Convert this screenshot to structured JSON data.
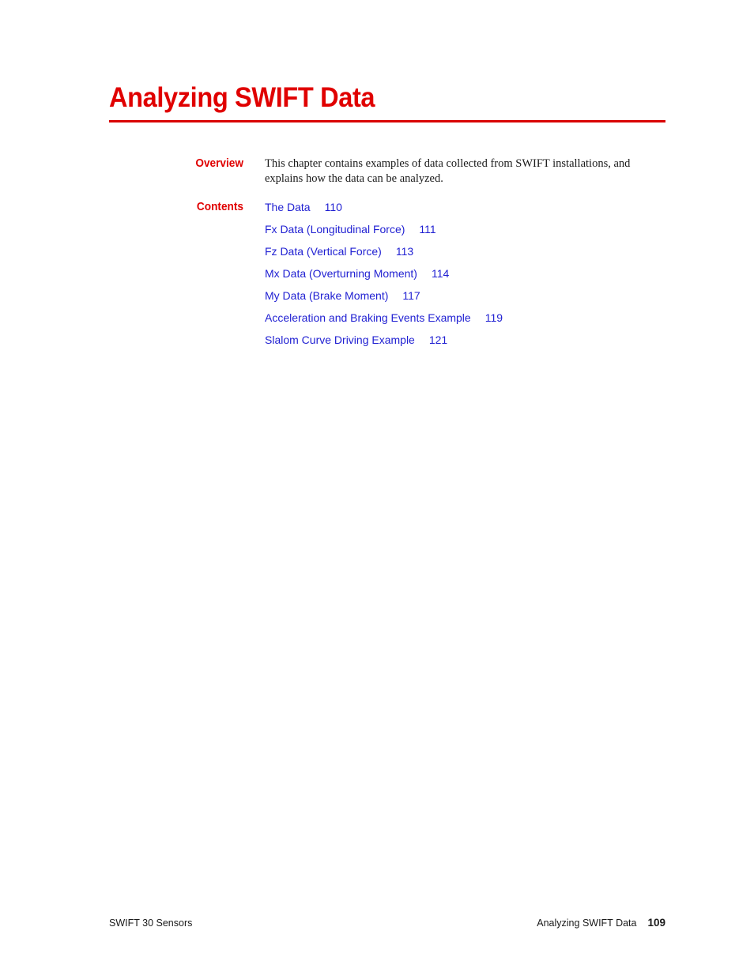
{
  "document": {
    "chapter_title": "Analyzing SWIFT Data"
  },
  "overview": {
    "label": "Overview",
    "text": "This chapter contains examples of data collected from SWIFT installations, and explains how the data can be analyzed."
  },
  "contents": {
    "label": "Contents",
    "items": [
      {
        "title": "The Data",
        "page": "110"
      },
      {
        "title": "Fx Data (Longitudinal Force)",
        "page": "111"
      },
      {
        "title": "Fz Data (Vertical Force)",
        "page": "113"
      },
      {
        "title": "Mx Data (Overturning Moment)",
        "page": "114"
      },
      {
        "title": "My Data (Brake Moment)",
        "page": "117"
      },
      {
        "title": "Acceleration and Braking Events Example",
        "page": "119"
      },
      {
        "title": "Slalom Curve Driving Example",
        "page": "121"
      }
    ]
  },
  "footer": {
    "left": "SWIFT 30 Sensors",
    "chapter": "Analyzing SWIFT Data",
    "page_number": "109"
  },
  "colors": {
    "heading_red": "#e00000",
    "rule_red": "#d90000",
    "link_blue": "#1f1fd2",
    "body_text": "#1a1a1a"
  }
}
